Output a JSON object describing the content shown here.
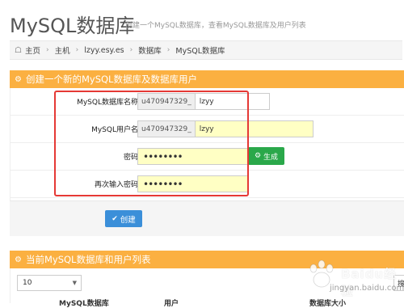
{
  "header": {
    "title": "MySQL数据库",
    "subtitle": "创建一个MySQL数据库，查看MySQL数据库及用户列表"
  },
  "breadcrumb": {
    "items": [
      "主页",
      "主机",
      "lzyy.esy.es",
      "数据库",
      "MySQL数据库"
    ]
  },
  "create_panel": {
    "title": "创建一个新的MySQL数据库及数据库用户",
    "fields": {
      "db_name": {
        "label": "MySQL数据库名称",
        "prefix": "u470947329_",
        "value": "lzyy"
      },
      "db_user": {
        "label": "MySQL用户名",
        "prefix": "u470947329_",
        "value": "lzyy"
      },
      "password": {
        "label": "密码",
        "value": "••••••••"
      },
      "password_confirm": {
        "label": "再次输入密码",
        "value": "••••••••"
      }
    },
    "generate_label": "生成",
    "create_label": "创建"
  },
  "list_panel": {
    "title": "当前MySQL数据库和用户列表",
    "page_size": "10",
    "search_text": "搜",
    "columns": [
      "MySQL数据库",
      "用户",
      "数据库大小"
    ]
  },
  "watermark": {
    "text": "Baidu经验",
    "url": "jingyan.baidu.com"
  },
  "colors": {
    "panel_header": "#fbb041",
    "generate_button": "#2aa84a",
    "create_button": "#3b8fd9",
    "highlight": "#e53935",
    "password_field": "#ffffc4"
  }
}
